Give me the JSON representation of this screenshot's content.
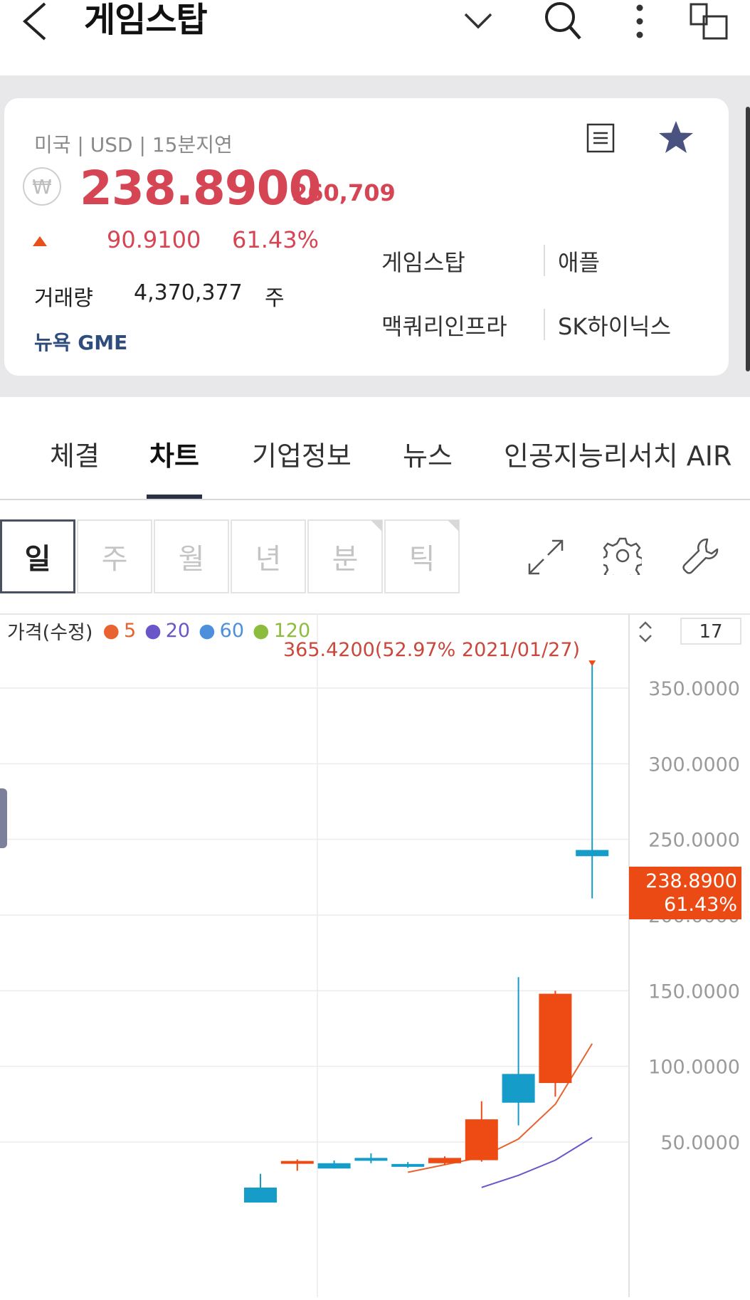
{
  "header": {
    "title": "게임스탑"
  },
  "stock": {
    "market_info": "미국 | USD | 15분지연",
    "currency_symbol": "₩",
    "price": "238.8900",
    "krw_price": "260,709",
    "change": "90.9100",
    "change_pct": "61.43%",
    "volume_label": "거래량",
    "volume": "4,370,377",
    "volume_unit": "주",
    "exchange": "뉴욕 GME",
    "related": [
      "게임스탑",
      "애플",
      "맥쿼리인프라",
      "SK하이닉스"
    ]
  },
  "tabs": [
    {
      "label": "체결",
      "active": false
    },
    {
      "label": "차트",
      "active": true
    },
    {
      "label": "기업정보",
      "active": false
    },
    {
      "label": "뉴스",
      "active": false
    },
    {
      "label": "인공지능리서치 AIR",
      "active": false
    }
  ],
  "periods": [
    {
      "label": "일",
      "active": true
    },
    {
      "label": "주",
      "active": false
    },
    {
      "label": "월",
      "active": false
    },
    {
      "label": "년",
      "active": false
    },
    {
      "label": "분",
      "active": false
    },
    {
      "label": "틱",
      "active": false
    }
  ],
  "chart_legend": {
    "label": "가격(수정)",
    "ma": [
      {
        "period": "5",
        "color": "#e8632f"
      },
      {
        "period": "20",
        "color": "#6a55c9"
      },
      {
        "period": "60",
        "color": "#4c8fdc"
      },
      {
        "period": "120",
        "color": "#8dbb3e"
      }
    ]
  },
  "chart_zoom": "17",
  "chart_high_label": "365.4200(52.97% 2021/01/27)",
  "current_price_badge": {
    "price": "238.8900",
    "pct": "61.43%"
  },
  "colors": {
    "up": "#ee4a14",
    "down": "#159cc8",
    "price_red": "#d64553",
    "badge": "#ec4a14"
  },
  "chart_data": {
    "type": "candlestick",
    "y_ticks": [
      "350.0000",
      "300.0000",
      "250.0000",
      "200.0000",
      "150.0000",
      "100.0000",
      "50.0000"
    ],
    "ylim": [
      0,
      365.42
    ],
    "candles": [
      {
        "open": 19.9,
        "close": 10.0,
        "high": 29.0,
        "low": 10.0
      },
      {
        "open": 36.0,
        "close": 37.5,
        "high": 38.5,
        "low": 31.0
      },
      {
        "open": 36.0,
        "close": 32.5,
        "high": 37.8,
        "low": 32.5
      },
      {
        "open": 39.5,
        "close": 38.0,
        "high": 42.5,
        "low": 36.0
      },
      {
        "open": 35.5,
        "close": 34.0,
        "high": 36.8,
        "low": 33.0
      },
      {
        "open": 36.0,
        "close": 39.5,
        "high": 40.5,
        "low": 35.0
      },
      {
        "open": 38.0,
        "close": 65.0,
        "high": 77.0,
        "low": 37.0
      },
      {
        "open": 95.0,
        "close": 76.0,
        "high": 159.0,
        "low": 61.0
      },
      {
        "open": 89.0,
        "close": 148.0,
        "high": 150.0,
        "low": 80.0
      },
      {
        "open": 243.0,
        "close": 238.89,
        "high": 365.42,
        "low": 211.0
      }
    ],
    "ma5": [
      null,
      null,
      null,
      null,
      30.0,
      35.0,
      40.0,
      52.0,
      75.0,
      115.0
    ],
    "ma20": [
      null,
      null,
      null,
      null,
      null,
      null,
      20.0,
      28.0,
      38.0,
      53.0
    ]
  }
}
